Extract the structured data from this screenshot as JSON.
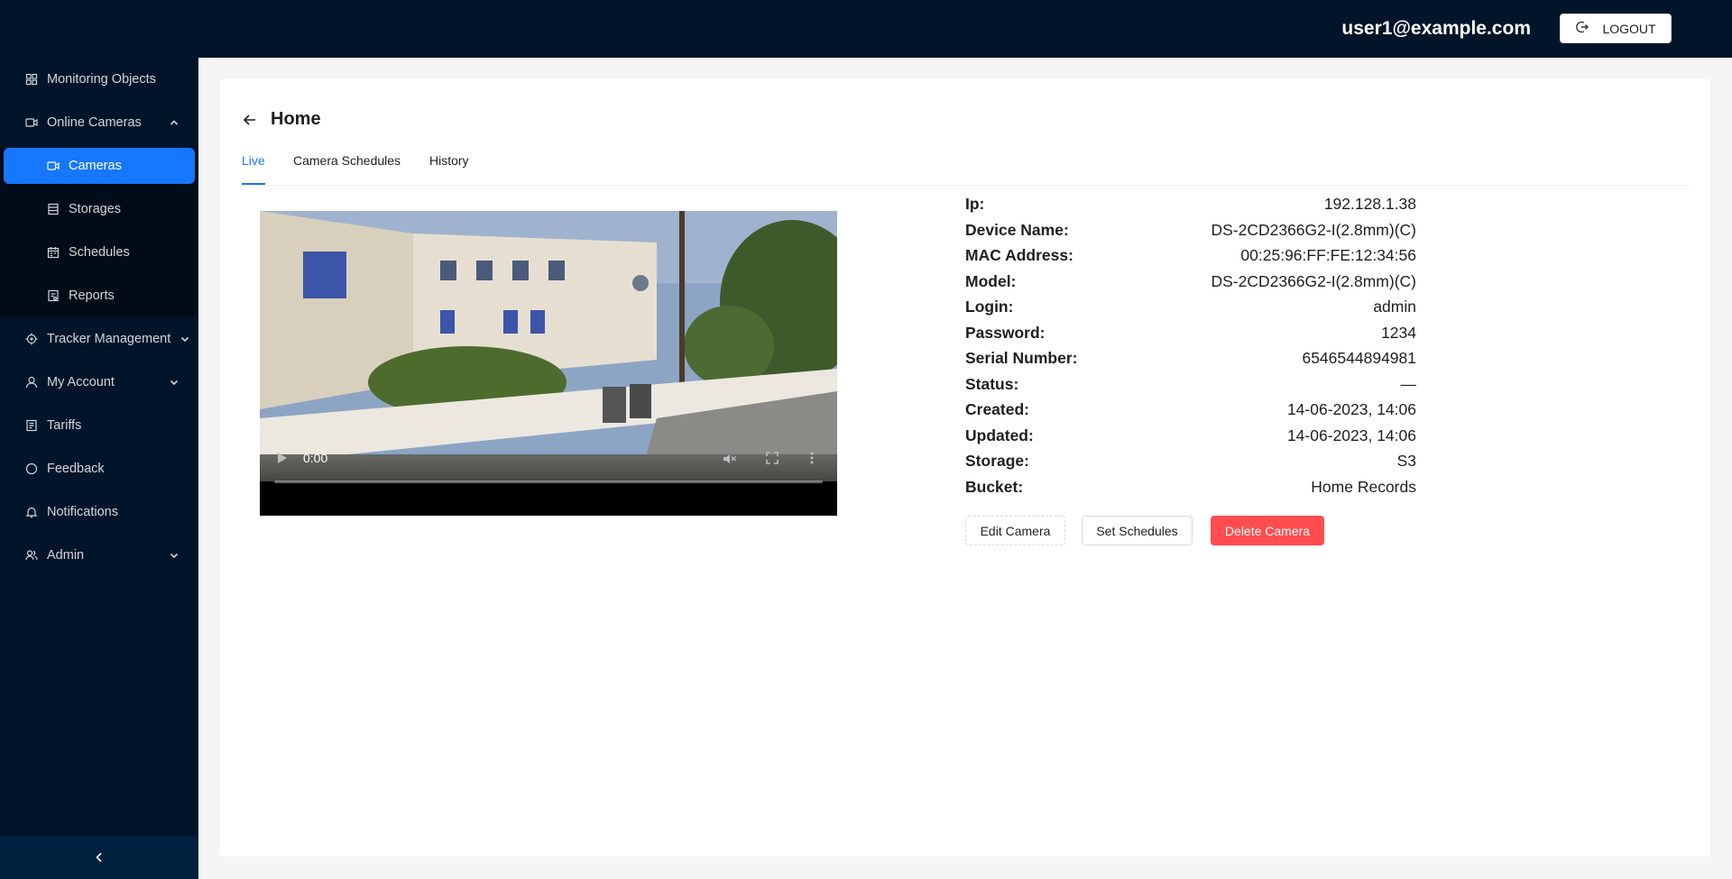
{
  "header": {
    "user_email": "user1@example.com",
    "logout_label": "LOGOUT"
  },
  "sidebar": {
    "items": [
      {
        "label": "Monitoring Objects",
        "icon": "grid-icon"
      },
      {
        "label": "Online Cameras",
        "icon": "video-camera-icon",
        "expanded": true
      },
      {
        "label": "Cameras",
        "icon": "video-camera-icon",
        "active": true
      },
      {
        "label": "Storages",
        "icon": "database-icon"
      },
      {
        "label": "Schedules",
        "icon": "calendar-icon"
      },
      {
        "label": "Reports",
        "icon": "report-icon"
      },
      {
        "label": "Tracker Management",
        "icon": "aim-icon"
      },
      {
        "label": "My Account",
        "icon": "user-icon"
      },
      {
        "label": "Tariffs",
        "icon": "file-icon"
      },
      {
        "label": "Feedback",
        "icon": "message-icon"
      },
      {
        "label": "Notifications",
        "icon": "bell-icon"
      },
      {
        "label": "Admin",
        "icon": "team-icon"
      }
    ],
    "collapse_icon": "chevron-left-icon"
  },
  "page": {
    "title": "Home",
    "tabs": [
      {
        "label": "Live",
        "active": true
      },
      {
        "label": "Camera Schedules"
      },
      {
        "label": "History"
      }
    ]
  },
  "video": {
    "time": "0:00",
    "progress": 0
  },
  "details": [
    {
      "key": "Ip:",
      "value": "192.128.1.38"
    },
    {
      "key": "Device Name:",
      "value": "DS-2CD2366G2-I(2.8mm)(C)"
    },
    {
      "key": "MAC Address:",
      "value": "00:25:96:FF:FE:12:34:56"
    },
    {
      "key": "Model:",
      "value": "DS-2CD2366G2-I(2.8mm)(C)"
    },
    {
      "key": "Login:",
      "value": "admin"
    },
    {
      "key": "Password:",
      "value": "1234"
    },
    {
      "key": "Serial Number:",
      "value": "6546544894981"
    },
    {
      "key": "Status:",
      "value": "—"
    },
    {
      "key": "Created:",
      "value": "14-06-2023, 14:06"
    },
    {
      "key": "Updated:",
      "value": "14-06-2023, 14:06"
    },
    {
      "key": "Storage:",
      "value": "S3"
    },
    {
      "key": "Bucket:",
      "value": "Home Records"
    }
  ],
  "actions": {
    "edit_label": "Edit Camera",
    "schedules_label": "Set Schedules",
    "delete_label": "Delete Camera"
  },
  "colors": {
    "sidebar_bg": "#001529",
    "accent": "#1677ff",
    "danger": "#ff4d4f"
  }
}
